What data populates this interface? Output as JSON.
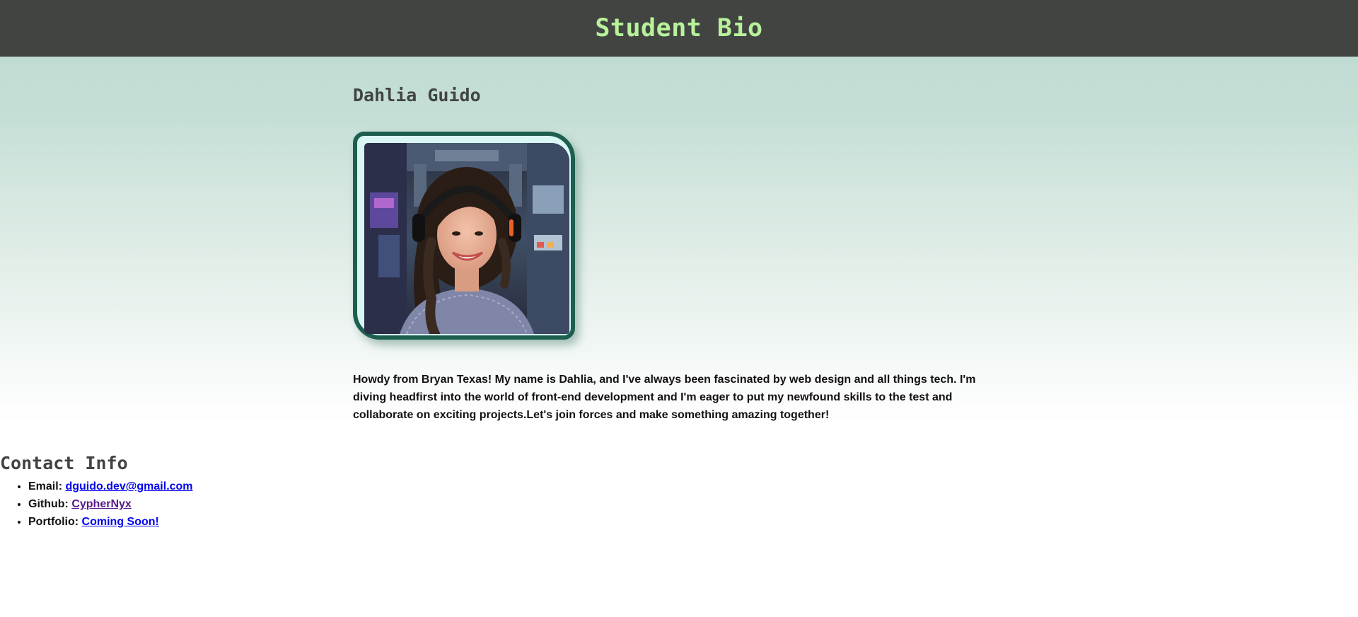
{
  "header": {
    "title": "Student Bio"
  },
  "bio": {
    "name": "Dahlia Guido",
    "photo_alt": "Photo of Dahlia Guido",
    "text": "Howdy from Bryan Texas! My name is Dahlia, and I've always been fascinated by web design and all things tech. I'm diving headfirst into the world of front-end development and I'm eager to put my newfound skills to the test and collaborate on exciting projects.Let's join forces and make something amazing together!"
  },
  "contact": {
    "heading": "Contact Info",
    "items": [
      {
        "label": "Email:",
        "link_text": "dguido.dev@gmail.com"
      },
      {
        "label": "Github:",
        "link_text": "CypherNyx"
      },
      {
        "label": "Portfolio:",
        "link_text": "Coming Soon!"
      }
    ]
  },
  "colors": {
    "header_bg": "#424442",
    "header_text": "#b7f29b",
    "frame_border": "#1d5e4f",
    "link": "#0000ee",
    "link_visited": "#551a8b"
  }
}
